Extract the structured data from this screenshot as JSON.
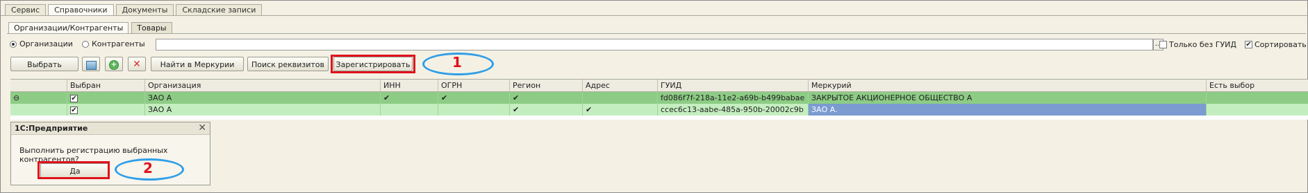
{
  "top_tabs": [
    "Сервис",
    "Справочники",
    "Документы",
    "Складские записи"
  ],
  "sub_tabs": [
    "Организации/Контрагенты",
    "Товары"
  ],
  "filter": {
    "radio_org": "Организации",
    "radio_contr": "Контрагенты",
    "search_value": "",
    "ellipsis": "...",
    "only_without_guid": "Только без ГУИД",
    "sort": "Сортировать"
  },
  "toolbar": {
    "select": "Выбрать",
    "find_mercury": "Найти в Меркурии",
    "search_requisites": "Поиск реквизитов",
    "register": "Зарегистрировать"
  },
  "annotations": {
    "step1": "1",
    "step2": "2"
  },
  "table": {
    "columns": [
      "",
      "Выбран",
      "Организация",
      "ИНН",
      "ОГРН",
      "Регион",
      "Адрес",
      "ГУИД",
      "Меркурий",
      "Есть выбор"
    ],
    "rows": [
      {
        "marker": "⊖",
        "selected": "✔",
        "org": "ЗАО  А",
        "inn": "✔",
        "ogrn": "✔",
        "region": "✔",
        "address": "",
        "guid": "fd086f7f-218a-11e2-a69b-b499babae",
        "mercury": "ЗАКРЫТОЕ АКЦИОНЕРНОЕ ОБЩЕСТВО  А",
        "has_choice": ""
      },
      {
        "marker": "",
        "selected": "✔",
        "org": "ЗАО  А",
        "inn": "",
        "ogrn": "",
        "region": "✔",
        "address": "✔",
        "guid": "ccec6c13-aabe-485a-950b-20002c9b",
        "mercury": "ЗАО  А.",
        "has_choice": ""
      }
    ]
  },
  "dialog": {
    "title": "1С:Предприятие",
    "message": "Выполнить регистрацию выбранных контрагентов?",
    "yes": "Да"
  }
}
